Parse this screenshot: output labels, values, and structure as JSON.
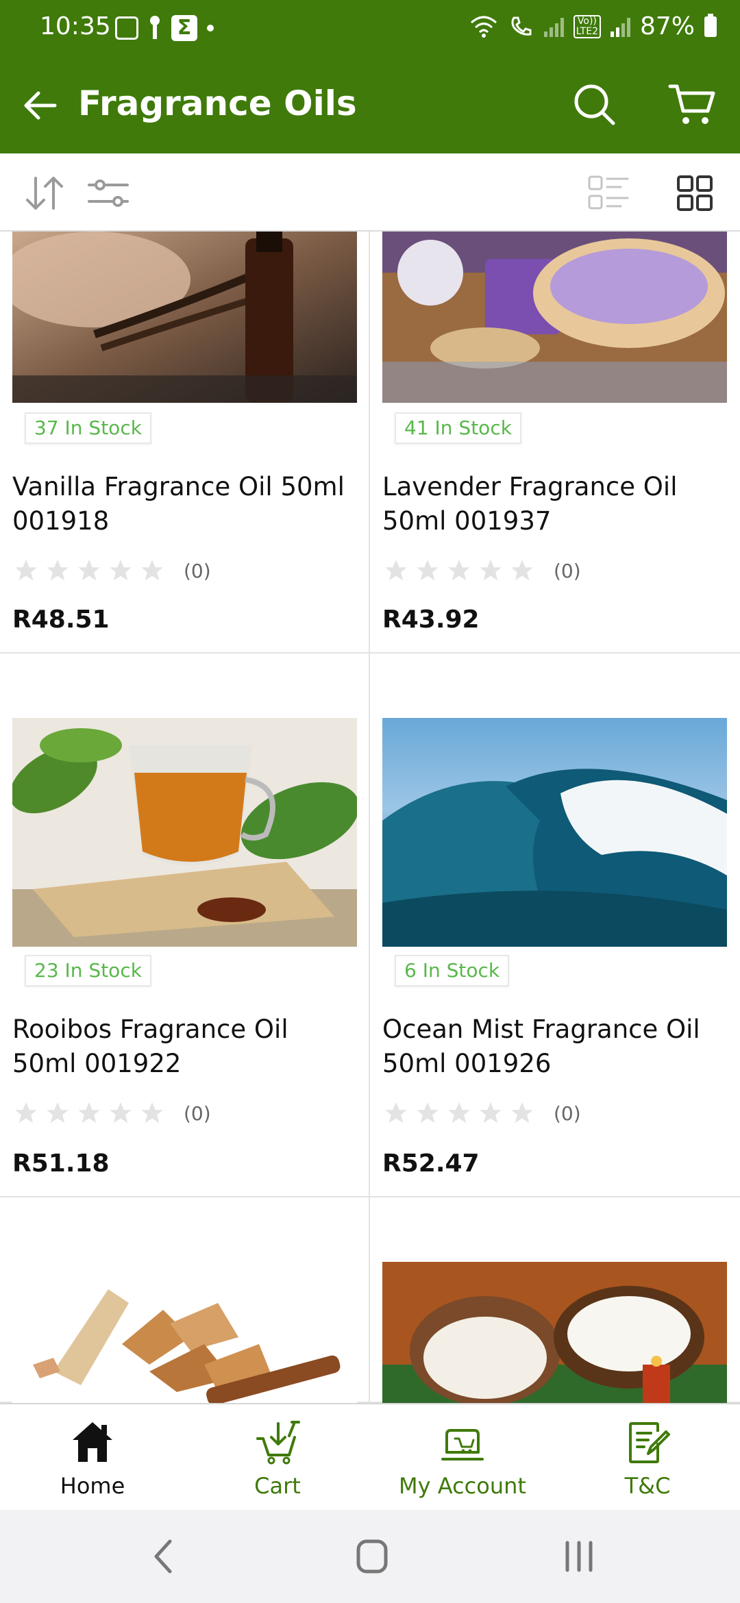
{
  "status_bar": {
    "time": "10:35",
    "battery": "87%",
    "volte_label": "Vo))\nLTE2"
  },
  "app_bar": {
    "title": "Fragrance Oils",
    "back_icon": "arrow-left-icon",
    "search_icon": "search-icon",
    "cart_icon": "cart-icon"
  },
  "toolbar": {
    "sort_icon": "sort-icon",
    "filter_icon": "filter-icon",
    "list_view_icon": "list-view-icon",
    "grid_view_icon": "grid-view-icon"
  },
  "products": [
    {
      "stock": "37 In Stock",
      "name": "Vanilla Fragrance Oil 50ml 001918",
      "rating": 0,
      "reviews": "(0)",
      "price": "R48.51"
    },
    {
      "stock": "41 In Stock",
      "name": "Lavender Fragrance Oil 50ml 001937",
      "rating": 0,
      "reviews": "(0)",
      "price": "R43.92"
    },
    {
      "stock": "23 In Stock",
      "name": "Rooibos Fragrance Oil 50ml 001922",
      "rating": 0,
      "reviews": "(0)",
      "price": "R51.18"
    },
    {
      "stock": "6 In Stock",
      "name": "Ocean Mist Fragrance Oil 50ml 001926",
      "rating": 0,
      "reviews": "(0)",
      "price": "R52.47"
    }
  ],
  "bottom_nav": [
    {
      "label": "Home",
      "icon": "home-icon",
      "active": true
    },
    {
      "label": "Cart",
      "icon": "cart-download-icon",
      "active": false
    },
    {
      "label": "My Account",
      "icon": "account-icon",
      "active": false
    },
    {
      "label": "T&C",
      "icon": "terms-icon",
      "active": false
    }
  ],
  "colors": {
    "brand": "#3f7a0a",
    "stock_text": "#58b84a",
    "star_empty": "#e3e3e3"
  }
}
